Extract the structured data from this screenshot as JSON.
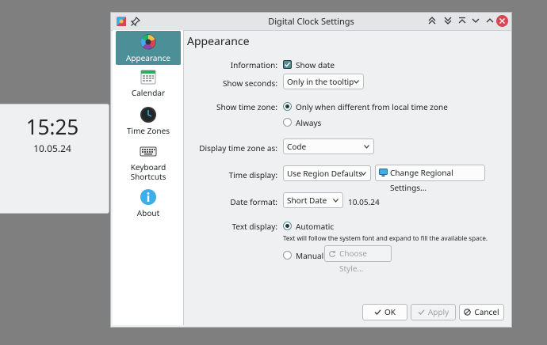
{
  "desktop_clock": {
    "time": "15:25",
    "date": "10.05.24"
  },
  "window": {
    "title": "Digital Clock Settings",
    "colors": {
      "accent": "#4c8f96",
      "close": "#da4453"
    }
  },
  "sidebar": {
    "items": [
      {
        "label": "Appearance",
        "icon": "appearance-icon",
        "active": true
      },
      {
        "label": "Calendar",
        "icon": "calendar-icon"
      },
      {
        "label": "Time Zones",
        "icon": "clock-icon"
      },
      {
        "label": "Keyboard",
        "label2": "Shortcuts",
        "icon": "keyboard-icon"
      },
      {
        "label": "About",
        "icon": "info-icon"
      }
    ]
  },
  "appearance": {
    "title": "Appearance",
    "information": {
      "label": "Information:",
      "checkbox": "Show date",
      "checked": true
    },
    "show_seconds": {
      "label": "Show seconds:",
      "value": "Only in the tooltip"
    },
    "show_time_zone": {
      "label": "Show time zone:",
      "option1": "Only when different from local time zone",
      "option2": "Always",
      "selected": "option1"
    },
    "display_tz_as": {
      "label": "Display time zone as:",
      "value": "Code"
    },
    "time_display": {
      "label": "Time display:",
      "value": "Use Region Defaults",
      "button": "Change Regional Settings..."
    },
    "date_format": {
      "label": "Date format:",
      "value": "Short Date",
      "preview": "10.05.24"
    },
    "text_display": {
      "label": "Text display:",
      "automatic": "Automatic",
      "hint": "Text will follow the system font and expand to fill the available space.",
      "manual": "Manual",
      "choose_style": "Choose Style..."
    }
  },
  "footer": {
    "ok": "OK",
    "apply": "Apply",
    "cancel": "Cancel"
  }
}
